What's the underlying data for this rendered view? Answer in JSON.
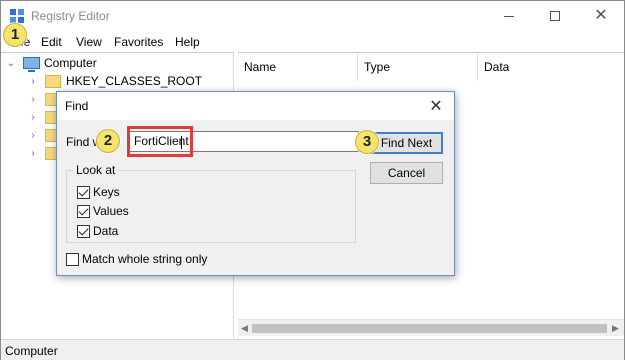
{
  "window": {
    "title": "Registry Editor"
  },
  "menu": [
    "File",
    "Edit",
    "View",
    "Favorites",
    "Help"
  ],
  "tree": {
    "root": "Computer",
    "items": [
      "HKEY_CLASSES_ROOT",
      "",
      "",
      "",
      ""
    ]
  },
  "list": {
    "columns": [
      "Name",
      "Type",
      "Data"
    ]
  },
  "status": {
    "text": "Computer"
  },
  "find_dialog": {
    "title": "Find",
    "find_what_label": "Find wh",
    "find_what_value": "FortiClient",
    "find_next": "Find Next",
    "cancel": "Cancel",
    "look_at_legend": "Look at",
    "look_at": [
      {
        "label": "Keys",
        "checked": true
      },
      {
        "label": "Values",
        "checked": true
      },
      {
        "label": "Data",
        "checked": true
      }
    ],
    "match_whole": {
      "label": "Match whole string only",
      "checked": false
    }
  },
  "callouts": [
    "1",
    "2",
    "3"
  ],
  "colors": {
    "highlight": "#e03c3c",
    "callout": "#f4e36c",
    "default_button_border": "#3c7fd1"
  },
  "icons": [
    "registry-app-icon",
    "computer-icon",
    "folder-icon",
    "chevron-right-icon",
    "chevron-down-icon",
    "close-icon"
  ]
}
